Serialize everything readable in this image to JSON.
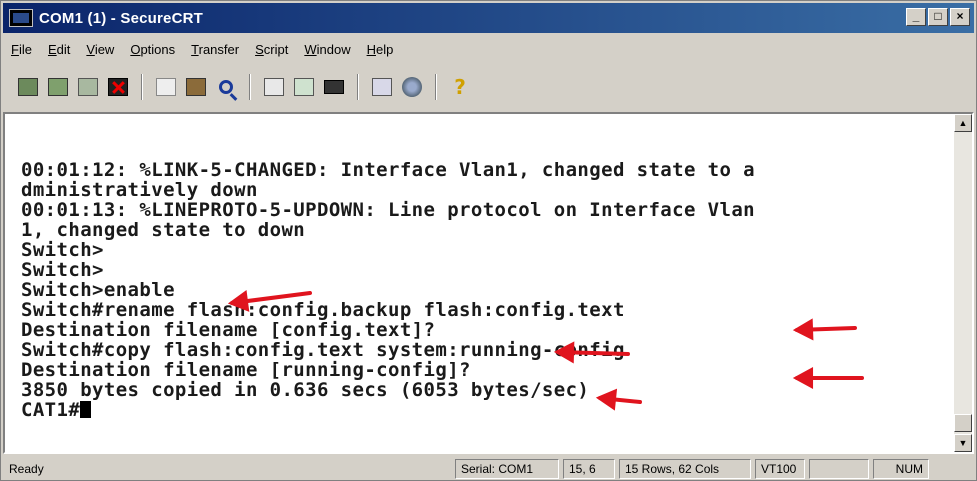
{
  "window": {
    "title": "COM1 (1) - SecureCRT",
    "controls": {
      "minimize": "_",
      "restore": "□",
      "close": "×"
    }
  },
  "menu": [
    "File",
    "Edit",
    "View",
    "Options",
    "Transfer",
    "Script",
    "Window",
    "Help"
  ],
  "toolbar": {
    "icons": [
      "connect-icon",
      "quick-connect-icon",
      "connect-in-tab-icon",
      "disconnect-icon",
      "copy-icon",
      "paste-icon",
      "find-icon",
      "send-file-icon",
      "log-session-icon",
      "print-icon",
      "session-options-icon",
      "global-options-icon",
      "help-icon"
    ],
    "help_glyph": "?"
  },
  "terminal": {
    "lines": [
      "00:01:12: %LINK-5-CHANGED: Interface Vlan1, changed state to a",
      "dministratively down",
      "00:01:13: %LINEPROTO-5-UPDOWN: Line protocol on Interface Vlan",
      "1, changed state to down",
      "Switch>",
      "Switch>",
      "Switch>enable",
      "Switch#rename flash:config.backup flash:config.text",
      "Destination filename [config.text]?",
      "Switch#copy flash:config.text system:running-config",
      "Destination filename [running-config]?",
      "3850 bytes copied in 0.636 secs (6053 bytes/sec)",
      "CAT1#"
    ],
    "annotation_color": "#e0141e"
  },
  "status": {
    "ready": "Ready",
    "serial": "Serial: COM1",
    "cursor_pos": "15,  6",
    "size": "15 Rows, 62 Cols",
    "emulation": "VT100",
    "blank": "",
    "num": "NUM"
  }
}
